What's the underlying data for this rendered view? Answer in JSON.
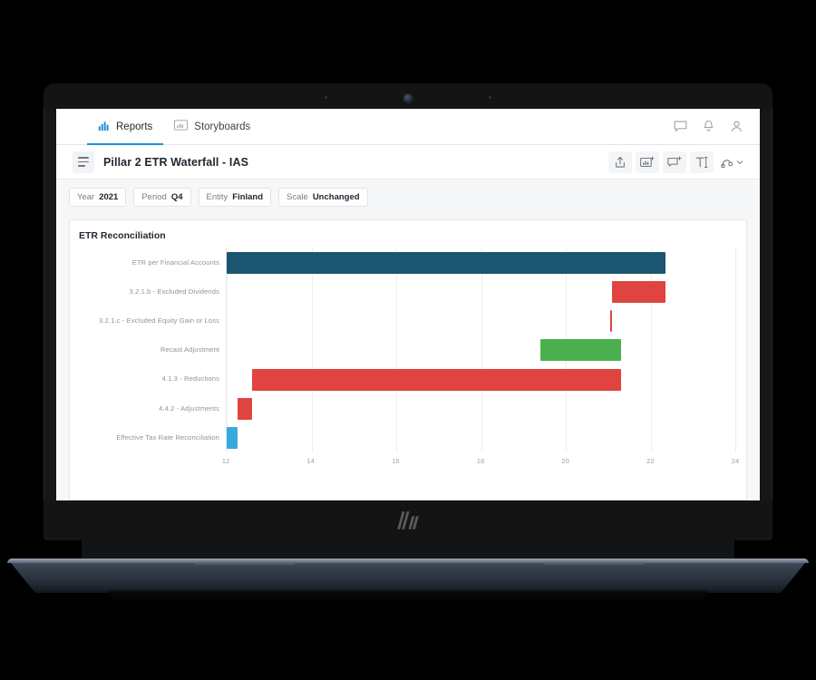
{
  "device": {
    "brand_logo": "hp-logo",
    "webcam": "webcam-icon"
  },
  "topnav": {
    "tabs": [
      {
        "label": "Reports",
        "icon": "bar-chart-icon",
        "active": true
      },
      {
        "label": "Storyboards",
        "icon": "storyboard-icon",
        "active": false
      }
    ],
    "icons": [
      {
        "name": "comment-icon"
      },
      {
        "name": "bell-icon"
      },
      {
        "name": "user-profile-icon"
      }
    ]
  },
  "titlebar": {
    "menu_icon": "hamburger-menu-icon",
    "title": "Pillar 2 ETR Waterfall - IAS",
    "tools": [
      {
        "name": "share-export-icon"
      },
      {
        "name": "add-chart-icon"
      },
      {
        "name": "add-comment-icon"
      },
      {
        "name": "text-tool-icon"
      },
      {
        "name": "shape-tool-icon"
      }
    ]
  },
  "filters": [
    {
      "label": "Year",
      "value": "2021"
    },
    {
      "label": "Period",
      "value": "Q4"
    },
    {
      "label": "Entity",
      "value": "Finland"
    },
    {
      "label": "Scale",
      "value": "Unchanged"
    }
  ],
  "card": {
    "title": "ETR Reconciliation"
  },
  "colors": {
    "total_teal": "#1b5570",
    "negative_red": "#e04441",
    "positive_green": "#4caf4f",
    "result_blue": "#3aa9dc",
    "grid": "#eceef0",
    "accent_blue": "#1b8fd6"
  },
  "chart_data": {
    "type": "bar",
    "subtype": "horizontal-waterfall",
    "title": "ETR Reconciliation",
    "xlabel": "",
    "ylabel": "",
    "xlim": [
      12,
      24
    ],
    "xticks": [
      12,
      14,
      16,
      18,
      20,
      22,
      24
    ],
    "grid": true,
    "legend": "none",
    "orientation": "horizontal",
    "categories": [
      "ETR per Financial Accounts",
      "3.2.1.b - Excluded Dividends",
      "3.2.1.c - Excluded Equity Gain or Loss",
      "Recast Adjustment",
      "4.1.3 - Reductions",
      "4.4.2 - Adjustments",
      "Effective Tax Rate Reconciliation"
    ],
    "bars": [
      {
        "category": "ETR per Financial Accounts",
        "start": 12.0,
        "end": 22.35,
        "delta": 22.35,
        "color": "#1b5570",
        "kind": "total"
      },
      {
        "category": "3.2.1.b - Excluded Dividends",
        "start": 21.1,
        "end": 22.35,
        "delta": -1.25,
        "color": "#e04441",
        "kind": "decrease"
      },
      {
        "category": "3.2.1.c - Excluded Equity Gain or Loss",
        "start": 21.04,
        "end": 21.1,
        "delta": -0.06,
        "color": "#e04441",
        "kind": "decrease"
      },
      {
        "category": "Recast Adjustment",
        "start": 19.4,
        "end": 21.3,
        "delta": 1.9,
        "color": "#4caf4f",
        "kind": "increase"
      },
      {
        "category": "4.1.3 - Reductions",
        "start": 12.6,
        "end": 21.3,
        "delta": -8.7,
        "color": "#e04441",
        "kind": "decrease"
      },
      {
        "category": "4.4.2 - Adjustments",
        "start": 12.25,
        "end": 12.6,
        "delta": -0.35,
        "color": "#e04441",
        "kind": "decrease"
      },
      {
        "category": "Effective Tax Rate Reconciliation",
        "start": 12.0,
        "end": 12.25,
        "delta": 12.25,
        "color": "#3aa9dc",
        "kind": "total"
      }
    ]
  }
}
